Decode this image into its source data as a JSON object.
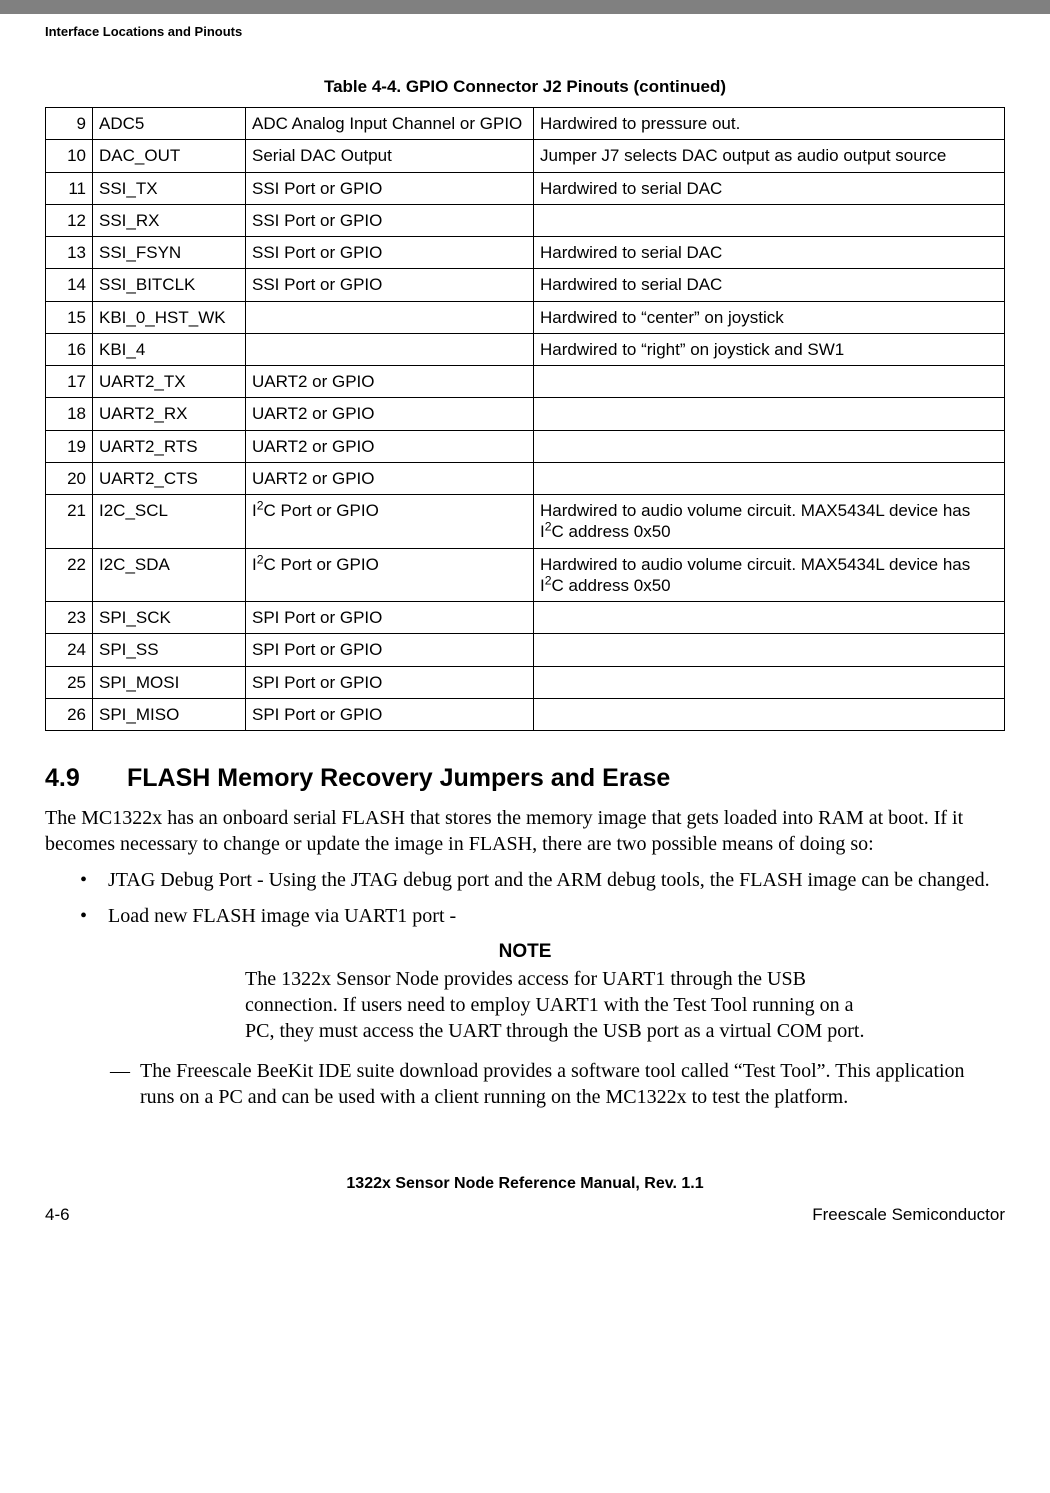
{
  "header_label": "Interface Locations and Pinouts",
  "table_title": "Table 4-4. GPIO Connector J2 Pinouts (continued)",
  "rows": [
    {
      "pin": "9",
      "name": "ADC5",
      "func": "ADC Analog Input Channel or GPIO",
      "note": "Hardwired to pressure out."
    },
    {
      "pin": "10",
      "name": "DAC_OUT",
      "func": "Serial DAC Output",
      "note": "Jumper J7 selects DAC output as audio output source"
    },
    {
      "pin": "11",
      "name": "SSI_TX",
      "func": "SSI Port or GPIO",
      "note": "Hardwired to serial DAC"
    },
    {
      "pin": "12",
      "name": "SSI_RX",
      "func": "SSI Port or GPIO",
      "note": ""
    },
    {
      "pin": "13",
      "name": "SSI_FSYN",
      "func": "SSI Port or GPIO",
      "note": "Hardwired to serial DAC"
    },
    {
      "pin": "14",
      "name": "SSI_BITCLK",
      "func": "SSI Port or GPIO",
      "note": "Hardwired to serial DAC"
    },
    {
      "pin": "15",
      "name": "KBI_0_HST_WK",
      "func": "",
      "note": "Hardwired to “center” on joystick"
    },
    {
      "pin": "16",
      "name": "KBI_4",
      "func": "",
      "note": "Hardwired to “right” on joystick and SW1"
    },
    {
      "pin": "17",
      "name": "UART2_TX",
      "func": "UART2 or GPIO",
      "note": ""
    },
    {
      "pin": "18",
      "name": "UART2_RX",
      "func": "UART2 or GPIO",
      "note": ""
    },
    {
      "pin": "19",
      "name": "UART2_RTS",
      "func": "UART2 or GPIO",
      "note": ""
    },
    {
      "pin": "20",
      "name": "UART2_CTS",
      "func": "UART2 or GPIO",
      "note": ""
    },
    {
      "pin": "21",
      "name": "I2C_SCL",
      "func_html": "I<sup>2</sup>C Port or GPIO",
      "note_html": "Hardwired to audio volume circuit. MAX5434L device has I<sup>2</sup>C address 0x50"
    },
    {
      "pin": "22",
      "name": "I2C_SDA",
      "func_html": "I<sup>2</sup>C Port or GPIO",
      "note_html": "Hardwired to audio volume circuit. MAX5434L device has I<sup>2</sup>C address 0x50"
    },
    {
      "pin": "23",
      "name": "SPI_SCK",
      "func": "SPI Port or GPIO",
      "note": ""
    },
    {
      "pin": "24",
      "name": "SPI_SS",
      "func": "SPI Port or GPIO",
      "note": ""
    },
    {
      "pin": "25",
      "name": "SPI_MOSI",
      "func": "SPI Port or GPIO",
      "note": ""
    },
    {
      "pin": "26",
      "name": "SPI_MISO",
      "func": "SPI Port or GPIO",
      "note": ""
    }
  ],
  "section_num": "4.9",
  "section_title": "FLASH Memory Recovery Jumpers and Erase",
  "intro": "The MC1322x has an onboard serial FLASH that stores the memory image that gets loaded into RAM at boot. If it becomes necessary to change or update the image in FLASH, there are two possible means of doing so:",
  "bullets": [
    "JTAG Debug Port - Using the JTAG debug port and the ARM debug tools, the FLASH image can be changed.",
    "Load new FLASH image via UART1 port -"
  ],
  "note_label": "NOTE",
  "note_body": "The 1322x Sensor Node provides access for UART1 through the USB connection. If users need to employ UART1 with the Test Tool running on a PC, they must access the UART through the USB port as a virtual COM port.",
  "sub_bullet": "The Freescale BeeKit IDE suite download provides a software tool called “Test Tool”. This application runs on a PC and can be used with a client running on the MC1322x to test the platform.",
  "footer_title": "1322x Sensor Node Reference Manual, Rev. 1.1",
  "footer_left": "4-6",
  "footer_right": "Freescale Semiconductor"
}
